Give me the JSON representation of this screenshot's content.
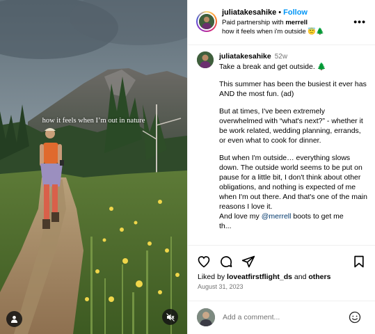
{
  "media": {
    "overlay_caption": "how it feels when I’m out in nature",
    "user_tag_icon": "person-icon",
    "mute_icon": "speaker-muted-icon"
  },
  "header": {
    "username": "juliatakesahike",
    "separator": "•",
    "follow_label": "Follow",
    "partner_prefix": "Paid partnership with ",
    "partner_name": "merrell",
    "audio_text": "how it feels when i'm outside 😇🌲",
    "more_icon": "more-options-icon",
    "more_label": "•••"
  },
  "caption": {
    "username": "juliatakesahike",
    "age": "52w",
    "paragraphs": [
      "Take a break and get outside. 🌲",
      "This summer has been the busiest it ever has AND the most fun. (ad)",
      "But at times, I've been extremely overwhelmed with “what's next?” - whether it be work related, wedding planning, errands, or even what to cook for dinner.",
      "But when I'm outside… everything slows down. The outside world seems to be put on pause for a little bit, I don't think about other obligations, and nothing is expected of me when I'm out there. And that's one of the main reasons I love it."
    ],
    "last_prefix": "And love my ",
    "last_mention": "@merrell",
    "last_suffix": " boots to get me",
    "cut_line": "th..."
  },
  "actions": {
    "like_icon": "heart-icon",
    "comment_icon": "comment-icon",
    "share_icon": "share-icon",
    "save_icon": "bookmark-icon",
    "liked_by_prefix": "Liked by ",
    "liked_by_user": "loveatfirstflight_ds",
    "liked_by_and": " and ",
    "liked_by_others": "others",
    "date": "August 31, 2023"
  },
  "comment_bar": {
    "placeholder": "Add a comment...",
    "emoji_icon": "smiley-icon"
  }
}
